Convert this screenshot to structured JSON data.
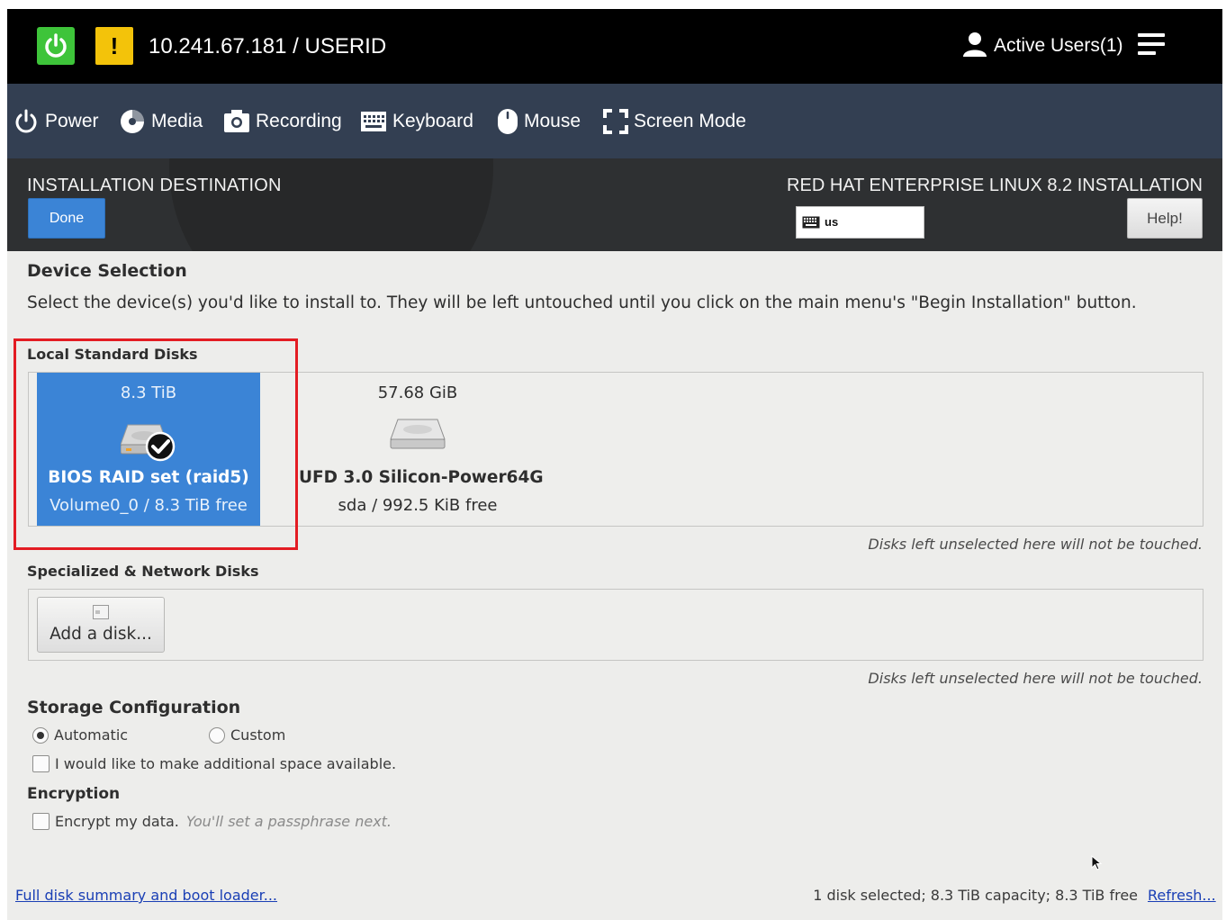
{
  "topbar": {
    "host": "10.241.67.181 / USERID",
    "warning_symbol": "!",
    "active_users": "Active Users(1)",
    "power_color": "#3ec43a",
    "warning_color": "#f3c30a"
  },
  "toolbar": {
    "items": [
      {
        "label": "Power",
        "icon": "power-icon"
      },
      {
        "label": "Media",
        "icon": "media-icon"
      },
      {
        "label": "Recording",
        "icon": "camera-icon"
      },
      {
        "label": "Keyboard",
        "icon": "keyboard-icon"
      },
      {
        "label": "Mouse",
        "icon": "mouse-icon"
      },
      {
        "label": "Screen Mode",
        "icon": "fullscreen-icon"
      }
    ]
  },
  "header": {
    "title": "INSTALLATION DESTINATION",
    "done_label": "Done",
    "product": "RED HAT ENTERPRISE LINUX 8.2 INSTALLATION",
    "keyboard_layout": "us",
    "help_label": "Help!",
    "accent_color": "#3b84d6"
  },
  "device_selection": {
    "title": "Device Selection",
    "description": "Select the device(s) you'd like to install to.  They will be left untouched until you click on the main menu's \"Begin Installation\" button."
  },
  "local_disks": {
    "label": "Local Standard Disks",
    "disks": [
      {
        "size": "8.3 TiB",
        "name": "BIOS RAID set (raid5)",
        "detail": "Volume0_0  /  8.3 TiB free",
        "selected": true
      },
      {
        "size": "57.68 GiB",
        "name": "UFD 3.0 Silicon-Power64G",
        "detail": "sda   /   992.5 KiB free",
        "selected": false
      }
    ],
    "note": "Disks left unselected here will not be touched."
  },
  "network_disks": {
    "label": "Specialized & Network Disks",
    "add_label": "Add a disk...",
    "note": "Disks left unselected here will not be touched."
  },
  "storage": {
    "title": "Storage Configuration",
    "automatic_label": "Automatic",
    "custom_label": "Custom",
    "selected": "Automatic",
    "reclaim_label": "I would like to make additional space available.",
    "reclaim_checked": false
  },
  "encryption": {
    "title": "Encryption",
    "encrypt_label": "Encrypt my data.",
    "encrypt_hint": "You'll set a passphrase next.",
    "encrypt_checked": false
  },
  "footer": {
    "summary_link": "Full disk summary and boot loader...",
    "status": "1 disk selected; 8.3 TiB capacity; 8.3 TiB free",
    "refresh_link": "Refresh..."
  }
}
